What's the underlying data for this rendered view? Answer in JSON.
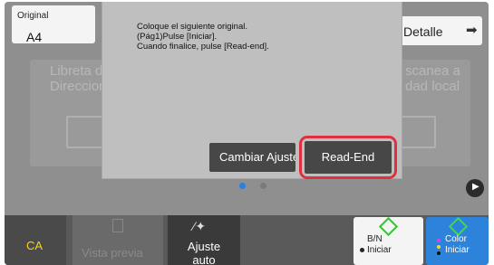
{
  "header": {
    "original_label": "Original",
    "original_value": "A4",
    "detalle_label": "Detalle",
    "detalle_icon": "arrow-right-icon"
  },
  "background_tiles": {
    "left_text_line1": "Libreta d",
    "left_text_line2": "Direccion",
    "right_text_line1": "scanea a",
    "right_text_line2": "dad local"
  },
  "dialog": {
    "line1": "Coloque el siguiente original.",
    "line2": "(Pág1)Pulse [Iniciar].",
    "line3": "Cuando finalice, pulse [Read-end].",
    "cambiar_label": "Cambiar Ajuste",
    "read_end_label": "Read-End",
    "highlight_color": "#e03040"
  },
  "pager": {
    "active_color": "#2a7fe0",
    "next_icon": "play-icon"
  },
  "bottom_bar": {
    "ca_label": "CA",
    "ca_color": "#f4d51c",
    "vista_label": "Vista previa",
    "ajuste_line1": "Ajuste",
    "ajuste_line2": "auto",
    "bn_line1": "B/N",
    "bn_line2": "Iniciar",
    "color_line1": "Color",
    "color_line2": "Iniciar",
    "color_bg": "#2d83d9",
    "start_icon_color": "#3cbf3c"
  }
}
